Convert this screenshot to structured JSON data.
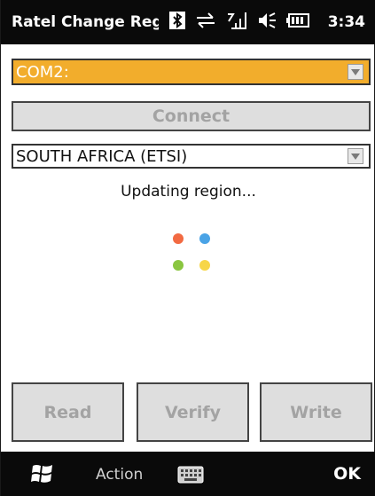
{
  "titlebar": {
    "app_title": "Ratel Change Regio",
    "time": "3:34",
    "icons": [
      "bluetooth-icon",
      "sync-icon",
      "signal-icon",
      "volume-icon",
      "battery-icon"
    ]
  },
  "com_port": {
    "value": "COM2:"
  },
  "connect_label": "Connect",
  "region": {
    "value": "SOUTH AFRICA (ETSI)"
  },
  "status_text": "Updating region...",
  "buttons": {
    "read": "Read",
    "verify": "Verify",
    "write": "Write"
  },
  "bottombar": {
    "left_softkey": "Action",
    "right_softkey": "OK"
  },
  "colors": {
    "combo_selected": "#f2ad2c",
    "bar_background": "#0a0a0a",
    "disabled_text": "#a3a3a3"
  }
}
